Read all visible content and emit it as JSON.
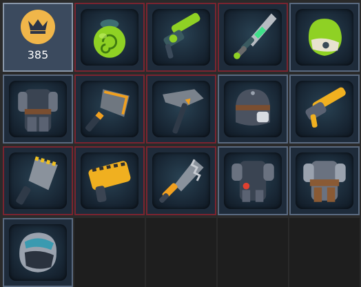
{
  "currency": {
    "icon": "crown-icon",
    "amount": "385",
    "badge_color": "#f0b64a"
  },
  "slots": [
    {
      "item": "green-swirl-bomb",
      "rarity": "red"
    },
    {
      "item": "green-blaster",
      "rarity": "red"
    },
    {
      "item": "green-blade-sword",
      "rarity": "red"
    },
    {
      "item": "green-rock-helmet",
      "rarity": "blue"
    },
    {
      "item": "dark-armor-torso",
      "rarity": "blue"
    },
    {
      "item": "orange-shovel-axe",
      "rarity": "red"
    },
    {
      "item": "steel-hammer",
      "rarity": "red"
    },
    {
      "item": "mask-helmet",
      "rarity": "blue"
    },
    {
      "item": "yellow-cannon",
      "rarity": "blue"
    },
    {
      "item": "striped-saw-blade",
      "rarity": "red"
    },
    {
      "item": "yellow-striped-launcher",
      "rarity": "red"
    },
    {
      "item": "jagged-saw-sword",
      "rarity": "red"
    },
    {
      "item": "dark-plate-armor",
      "rarity": "blue"
    },
    {
      "item": "leather-armor-torso",
      "rarity": "blue"
    },
    {
      "item": "blue-visor-helmet",
      "rarity": "blue"
    },
    {
      "item": "empty",
      "rarity": "none"
    },
    {
      "item": "empty",
      "rarity": "none"
    },
    {
      "item": "empty",
      "rarity": "none"
    },
    {
      "item": "empty",
      "rarity": "none"
    }
  ],
  "colors": {
    "red_border": "#7a2430",
    "blue_border": "#5a6a80",
    "empty_bg": "#1e1e1e"
  }
}
